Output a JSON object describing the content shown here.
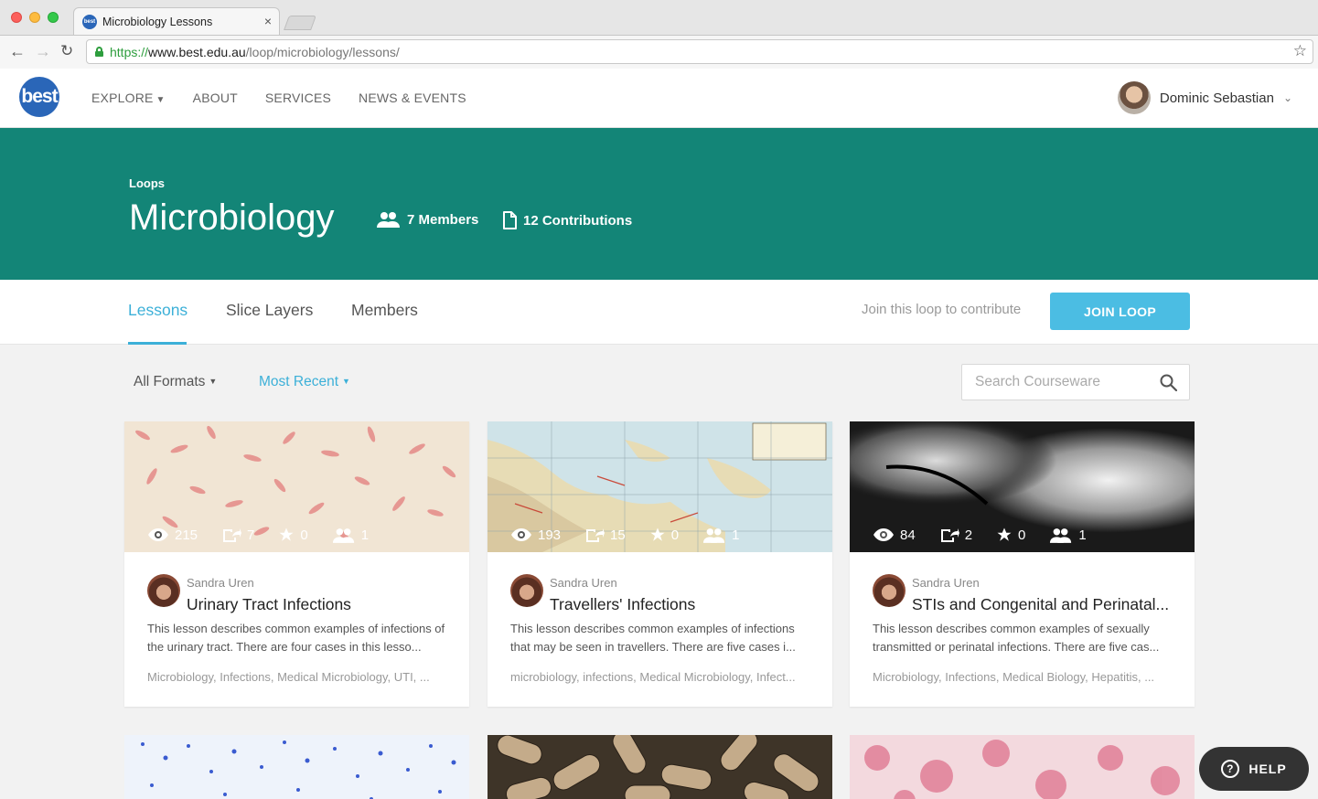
{
  "browser": {
    "tab_title": "Microbiology Lessons",
    "favicon_text": "best",
    "tab_close": "×",
    "url_scheme": "https://",
    "url_host": "www.best.edu.au",
    "url_path": "/loop/microbiology/lessons/"
  },
  "header": {
    "logo_text": "best",
    "nav": [
      {
        "label": "EXPLORE",
        "has_dropdown": true
      },
      {
        "label": "ABOUT"
      },
      {
        "label": "SERVICES"
      },
      {
        "label": "NEWS & EVENTS"
      }
    ],
    "user_name": "Dominic Sebastian"
  },
  "hero": {
    "breadcrumb": "Loops",
    "title": "Microbiology",
    "members": "7 Members",
    "contributions": "12 Contributions",
    "bg_color": "#138577"
  },
  "subnav": {
    "tabs": [
      {
        "label": "Lessons",
        "active": true
      },
      {
        "label": "Slice Layers"
      },
      {
        "label": "Members"
      }
    ],
    "join_text": "Join this loop to contribute",
    "join_button": "JOIN LOOP",
    "accent_color": "#3cb0d8"
  },
  "filters": {
    "formats": "All Formats",
    "sort": "Most Recent",
    "search_placeholder": "Search Courseware"
  },
  "cards": [
    {
      "image": "pink-bacteria-micrograph",
      "views": "215",
      "shares": "7",
      "stars": "0",
      "members": "1",
      "author": "Sandra Uren",
      "title": "Urinary Tract Infections",
      "description": "This lesson describes common examples of infections of the urinary tract. There are four cases in this lesso...",
      "tags": "Microbiology, Infections, Medical Microbiology, UTI, ..."
    },
    {
      "image": "pacific-map",
      "views": "193",
      "shares": "15",
      "stars": "0",
      "members": "1",
      "author": "Sandra Uren",
      "title": "Travellers' Infections",
      "description": "This lesson describes common examples of infections that may be seen in travellers. There are five cases i...",
      "tags": "microbiology, infections, Medical Microbiology, Infect..."
    },
    {
      "image": "black-white-micrograph",
      "views": "84",
      "shares": "2",
      "stars": "0",
      "members": "1",
      "author": "Sandra Uren",
      "title": "STIs and Congenital and Perinatal...",
      "description": "This lesson describes common examples of sexually transmitted or perinatal infections. There are five cas...",
      "tags": "Microbiology, Infections, Medical Biology, Hepatitis, ..."
    }
  ],
  "help_label": "HELP"
}
